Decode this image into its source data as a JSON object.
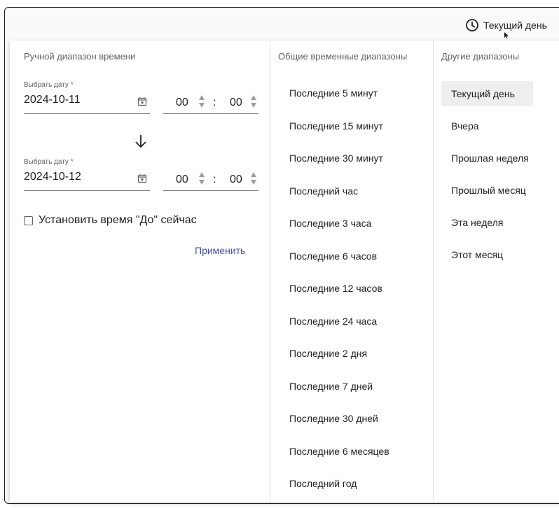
{
  "trigger": {
    "label": "Текущий день",
    "icon": "clock-icon"
  },
  "manual": {
    "title": "Ручной диапазон времени",
    "from": {
      "label": "Выбрать дату *",
      "date": "2024-10-11",
      "hours": "00",
      "minutes": "00"
    },
    "to": {
      "label": "Выбрать дату *",
      "date": "2024-10-12",
      "hours": "00",
      "minutes": "00"
    },
    "time_separator": ":",
    "set_to_now_label": "Установить время \"До\" сейчас",
    "apply_label": "Применить"
  },
  "common": {
    "title": "Общие временные диапазоны",
    "items": [
      "Последние 5 минут",
      "Последние 15 минут",
      "Последние 30 минут",
      "Последний час",
      "Последние 3 часа",
      "Последние 6 часов",
      "Последние 12 часов",
      "Последние 24 часа",
      "Последние 2 дня",
      "Последние 7 дней",
      "Последние 30 дней",
      "Последние 6 месяцев",
      "Последний год"
    ]
  },
  "other": {
    "title": "Другие диапазоны",
    "items": [
      "Текущий день",
      "Вчера",
      "Прошлая неделя",
      "Прошлый месяц",
      "Эта неделя",
      "Этот месяц"
    ],
    "active_index": 0
  },
  "colors": {
    "accent": "#3f51b5",
    "active_bg": "#eeeeee"
  }
}
